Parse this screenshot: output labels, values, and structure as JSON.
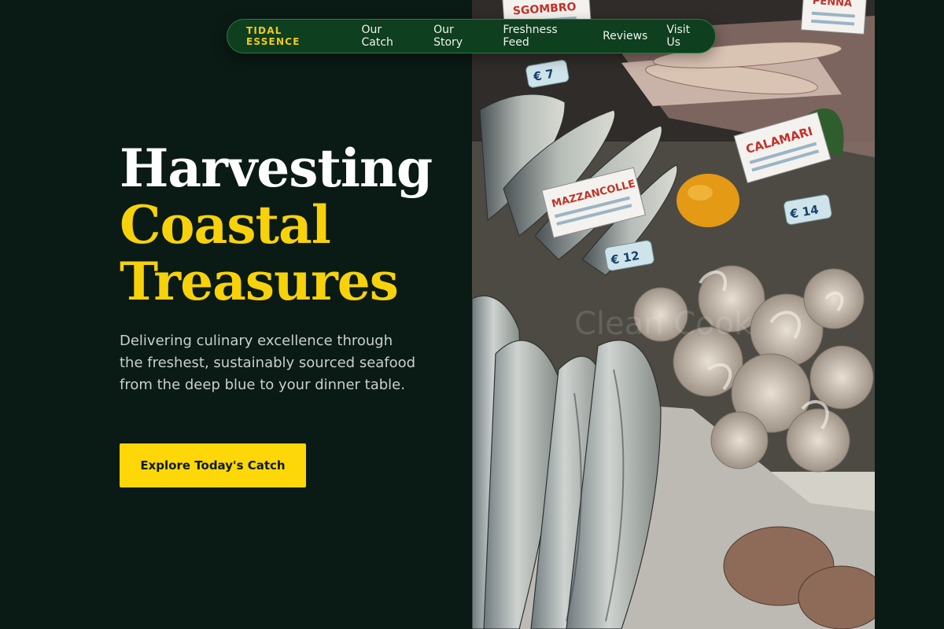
{
  "nav": {
    "brand": "TIDAL ESSENCE",
    "links": [
      "Our Catch",
      "Our Story",
      "Freshness Feed",
      "Reviews",
      "Visit Us"
    ]
  },
  "hero": {
    "title_line1": "Harvesting",
    "title_line2": "Coastal",
    "title_line3": "Treasures",
    "subtitle": "Delivering culinary excellence through the freshest, sustainably sourced seafood from the deep blue to your dinner table.",
    "cta_label": "Explore Today's Catch"
  },
  "photo": {
    "labels": [
      "SGOMBRO",
      "PENNA",
      "CALAMARI",
      "MAZZANCOLLE"
    ],
    "prices": [
      "€ 7",
      "€ 14",
      "€ 12"
    ],
    "watermark": "Clean Cook"
  },
  "colors": {
    "background": "#0a1a15",
    "accent": "#fed709",
    "nav_bg": "#0e3f1f",
    "text": "#c9d0cc"
  }
}
